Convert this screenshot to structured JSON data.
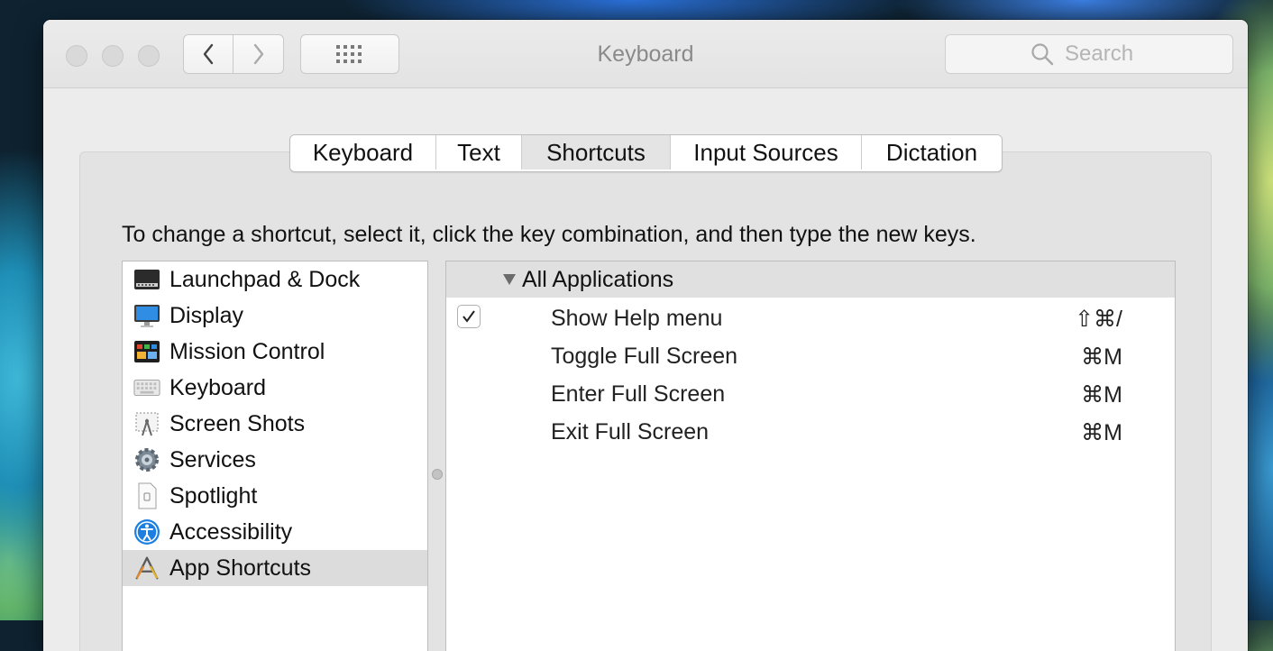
{
  "window": {
    "title": "Keyboard",
    "search_placeholder": "Search"
  },
  "tabs": [
    {
      "label": "Keyboard",
      "active": false
    },
    {
      "label": "Text",
      "active": false
    },
    {
      "label": "Shortcuts",
      "active": true
    },
    {
      "label": "Input Sources",
      "active": false
    },
    {
      "label": "Dictation",
      "active": false
    }
  ],
  "instructions": "To change a shortcut, select it, click the key combination, and then type the new keys.",
  "categories": [
    {
      "label": "Launchpad & Dock",
      "icon": "launchpad-dock-icon"
    },
    {
      "label": "Display",
      "icon": "display-icon"
    },
    {
      "label": "Mission Control",
      "icon": "mission-control-icon"
    },
    {
      "label": "Keyboard",
      "icon": "keyboard-icon"
    },
    {
      "label": "Screen Shots",
      "icon": "screen-shots-icon"
    },
    {
      "label": "Services",
      "icon": "services-gear-icon"
    },
    {
      "label": "Spotlight",
      "icon": "spotlight-icon"
    },
    {
      "label": "Accessibility",
      "icon": "accessibility-icon"
    },
    {
      "label": "App Shortcuts",
      "icon": "app-shortcuts-icon",
      "selected": true
    }
  ],
  "shortcuts": {
    "group": "All Applications",
    "rows": [
      {
        "name": "Show Help menu",
        "keys": "⇧⌘/",
        "checked": true
      },
      {
        "name": "Toggle Full Screen",
        "keys": "⌘M"
      },
      {
        "name": "Enter Full Screen",
        "keys": "⌘M"
      },
      {
        "name": "Exit Full Screen",
        "keys": "⌘M"
      }
    ]
  }
}
